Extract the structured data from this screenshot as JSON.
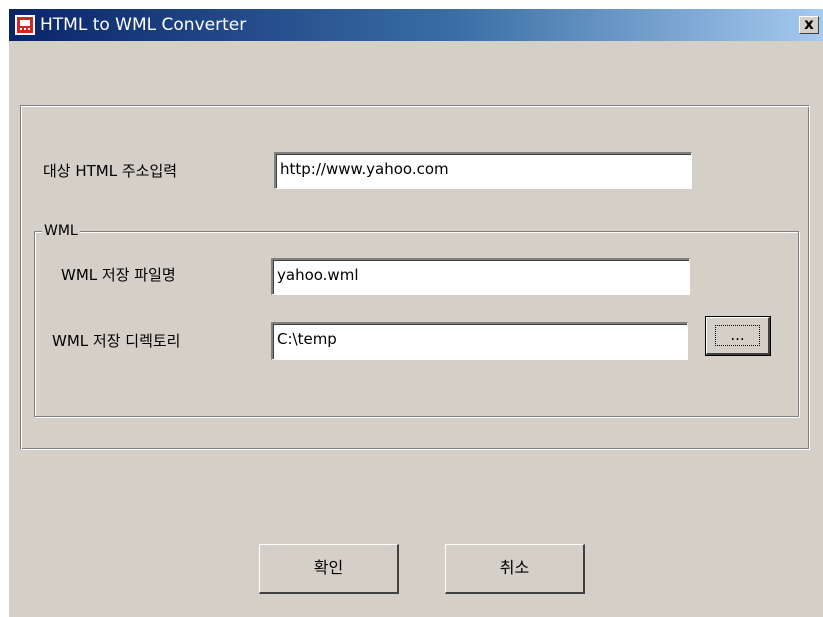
{
  "window": {
    "title": "HTML to WML Converter",
    "close_label": "x"
  },
  "form": {
    "url_label": "대상 HTML 주소입력",
    "url_value": "http://www.yahoo.com",
    "wml_group_label": "WML",
    "filename_label": "WML 저장 파일명",
    "filename_value": "yahoo.wml",
    "directory_label": "WML 저장 디렉토리",
    "directory_value": "C:\\temp",
    "browse_label": "..."
  },
  "buttons": {
    "ok_label": "확인",
    "cancel_label": "취소"
  },
  "colors": {
    "titlebar_start": "#0a246a",
    "titlebar_end": "#a6caf0",
    "window_bg": "#d4d0c8",
    "app_icon": "#d8261f"
  },
  "icons": {
    "app": "app-icon",
    "close": "close-icon"
  }
}
